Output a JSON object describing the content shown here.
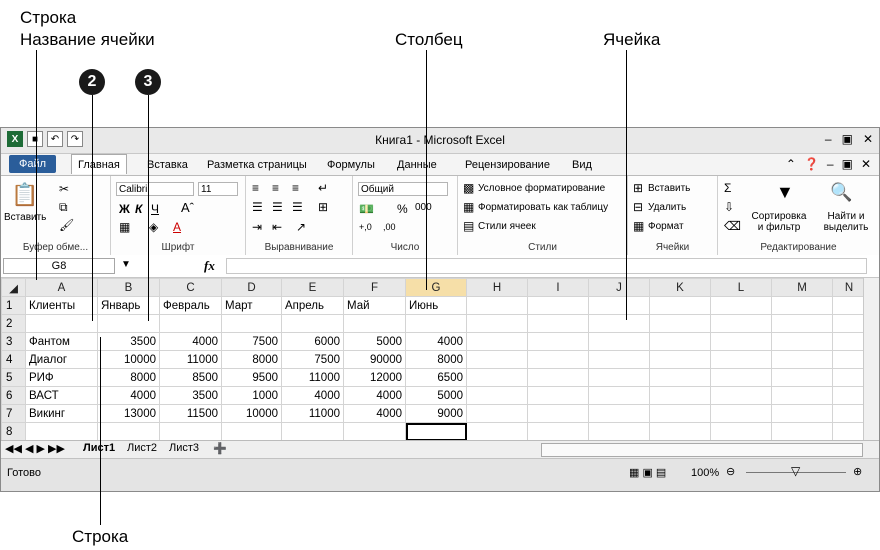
{
  "annotations": {
    "row_top": "Строка",
    "cell_name": "Название ячейки",
    "column": "Столбец",
    "cell": "Ячейка",
    "row_bottom": "Строка",
    "marker_2": "2",
    "marker_3": "3"
  },
  "window": {
    "title": "Книга1 - Microsoft Excel",
    "app_icon": "X"
  },
  "tabs": [
    "Файл",
    "Главная",
    "Вставка",
    "Разметка страницы",
    "Формулы",
    "Данные",
    "Рецензирование",
    "Вид"
  ],
  "ribbon": {
    "clipboard": {
      "paste": "Вставить",
      "label": "Буфер обме..."
    },
    "font": {
      "name": "Calibri",
      "size": "11",
      "bold": "Ж",
      "italic": "К",
      "underline": "Ч",
      "label": "Шрифт"
    },
    "alignment": {
      "label": "Выравнивание"
    },
    "number": {
      "format": "Общий",
      "label": "Число"
    },
    "styles": {
      "conditional": "Условное форматирование",
      "as_table": "Форматировать как таблицу",
      "cell_styles": "Стили ячеек",
      "label": "Стили"
    },
    "cells": {
      "insert": "Вставить",
      "delete": "Удалить",
      "format": "Формат",
      "label": "Ячейки"
    },
    "editing": {
      "sort": "Сортировка и фильтр",
      "find": "Найти и выделить",
      "label": "Редактирование"
    }
  },
  "formula_bar": {
    "name_box": "G8",
    "fx": "fx",
    "value": ""
  },
  "sheet": {
    "columns": [
      "A",
      "B",
      "C",
      "D",
      "E",
      "F",
      "G",
      "H",
      "I",
      "J",
      "K",
      "L",
      "M",
      "N"
    ],
    "rows": [
      [
        "1",
        "Клиенты",
        "Январь",
        "Февраль",
        "Март",
        "Апрель",
        "Май",
        "Июнь",
        "",
        "",
        "",
        "",
        "",
        ""
      ],
      [
        "2",
        "",
        "",
        "",
        "",
        "",
        "",
        "",
        "",
        "",
        "",
        "",
        "",
        ""
      ],
      [
        "3",
        "Фантом",
        "3500",
        "4000",
        "7500",
        "6000",
        "5000",
        "4000",
        "",
        "",
        "",
        "",
        "",
        ""
      ],
      [
        "4",
        "Диалог",
        "10000",
        "11000",
        "8000",
        "7500",
        "90000",
        "8000",
        "",
        "",
        "",
        "",
        "",
        ""
      ],
      [
        "5",
        "РИФ",
        "8000",
        "8500",
        "9500",
        "11000",
        "12000",
        "6500",
        "",
        "",
        "",
        "",
        "",
        ""
      ],
      [
        "6",
        "ВАСТ",
        "4000",
        "3500",
        "1000",
        "4000",
        "4000",
        "5000",
        "",
        "",
        "",
        "",
        "",
        ""
      ],
      [
        "7",
        "Викинг",
        "13000",
        "11500",
        "10000",
        "11000",
        "4000",
        "9000",
        "",
        "",
        "",
        "",
        "",
        ""
      ],
      [
        "8",
        "",
        "",
        "",
        "",
        "",
        "",
        "",
        "",
        "",
        "",
        "",
        "",
        ""
      ]
    ]
  },
  "sheet_tabs": [
    "Лист1",
    "Лист2",
    "Лист3"
  ],
  "status": {
    "ready": "Готово",
    "zoom": "100%"
  }
}
